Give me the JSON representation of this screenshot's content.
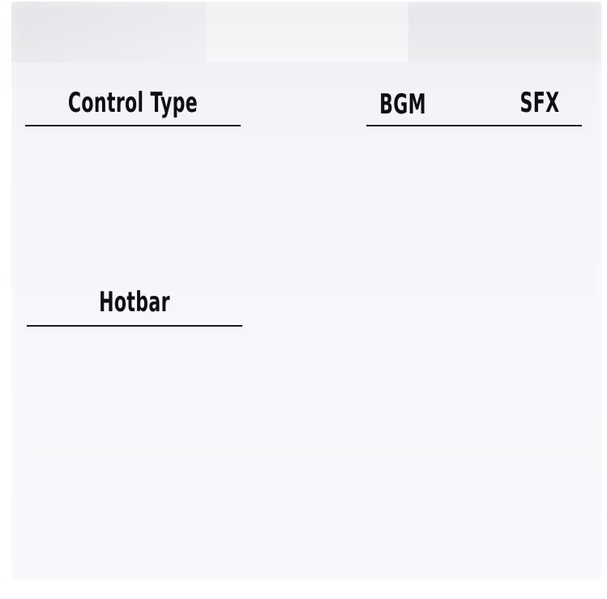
{
  "settings": {
    "control_type": {
      "label": "Control Type"
    },
    "audio": {
      "bgm_label": "BGM",
      "sfx_label": "SFX"
    },
    "hotbar": {
      "label": "Hotbar"
    }
  },
  "colors": {
    "panel_background": "#f3f5f8",
    "text": "#0e0f12",
    "divider": "#1a1c20"
  }
}
